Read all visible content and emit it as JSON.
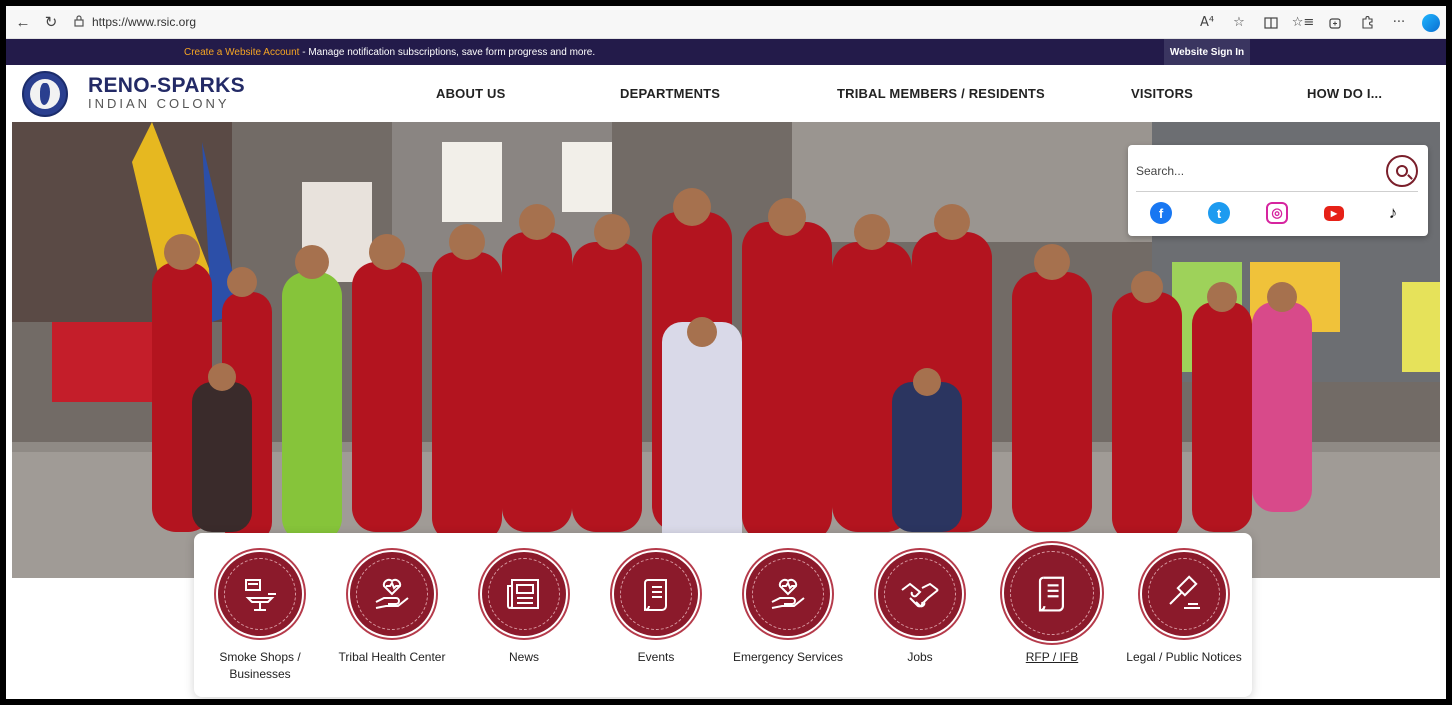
{
  "browser": {
    "url": "https://www.rsic.org",
    "icons": [
      "back-icon",
      "reload-icon",
      "lock-icon",
      "read-aloud-icon",
      "favorite-star-icon",
      "split-screen-icon",
      "favorites-icon",
      "collections-icon",
      "extensions-icon",
      "more-icon",
      "edge-logo-icon"
    ],
    "read_aloud_glyph": "A⁴",
    "more_glyph": "···"
  },
  "notify": {
    "link_text": "Create a Website Account",
    "text": " - Manage notification subscriptions, save form progress and more.",
    "signin_label": "Website Sign In"
  },
  "brand": {
    "line1": "RENO-SPARKS",
    "line2": "INDIAN COLONY",
    "logo_alt": "Reno-Sparks Indian Colony seal",
    "logo_text": "Reno-Sparks Indian Colony Est. 1917"
  },
  "nav": {
    "items": [
      {
        "label": "ABOUT US"
      },
      {
        "label": "DEPARTMENTS"
      },
      {
        "label": "TRIBAL MEMBERS / RESIDENTS"
      },
      {
        "label": "VISITORS"
      },
      {
        "label": "HOW DO I..."
      }
    ]
  },
  "search": {
    "placeholder": "Search...",
    "social": [
      {
        "name": "facebook",
        "glyph": "f",
        "color": "#1877f2"
      },
      {
        "name": "twitter",
        "glyph": "t",
        "color": "#1d9bf0"
      },
      {
        "name": "instagram",
        "glyph": "◎",
        "color": "#d6249f"
      },
      {
        "name": "youtube",
        "glyph": "▶",
        "color": "#e62117"
      },
      {
        "name": "tiktok",
        "glyph": "♪",
        "color": "#111111"
      }
    ]
  },
  "quicklinks": [
    {
      "label": "Smoke Shops / Businesses",
      "icon": "smoke-shop-icon"
    },
    {
      "label": "Tribal Health Center",
      "icon": "heart-hand-icon"
    },
    {
      "label": "News",
      "icon": "newspaper-icon"
    },
    {
      "label": "Events",
      "icon": "scroll-icon"
    },
    {
      "label": "Emergency Services",
      "icon": "heart-hand-icon"
    },
    {
      "label": "Jobs",
      "icon": "handshake-icon"
    },
    {
      "label": "RFP / IFB",
      "icon": "document-icon"
    },
    {
      "label": "Legal / Public Notices",
      "icon": "gavel-icon"
    }
  ],
  "colors": {
    "accent": "#8b1a2b",
    "notify_bg": "#231b4a",
    "brand_navy": "#232a66",
    "link_orange": "#f5a524"
  }
}
